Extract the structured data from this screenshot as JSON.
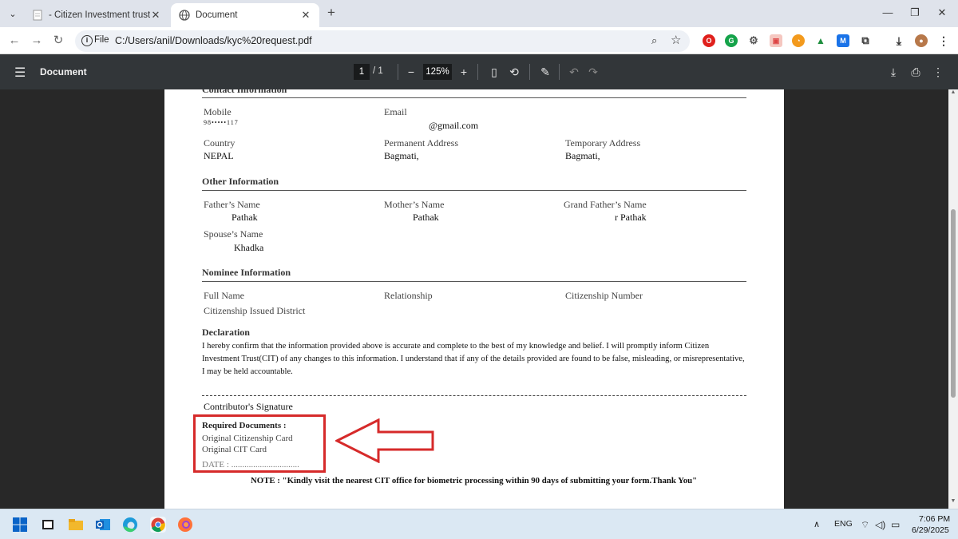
{
  "browser": {
    "tabs": [
      {
        "title": "- Citizen Investment trust from",
        "active": false
      },
      {
        "title": "Document",
        "active": true
      }
    ],
    "address": {
      "scheme_label": "File",
      "url": "C:/Users/anil/Downloads/kyc%20request.pdf"
    }
  },
  "pdf_toolbar": {
    "title": "Document",
    "page_current": "1",
    "page_total": "/ 1",
    "zoom": "125%"
  },
  "document": {
    "contact_heading": "Contact Information",
    "contact": {
      "mobile_label": "Mobile",
      "mobile_value": "98•••••117",
      "email_label": "Email",
      "email_value": "@gmail.com",
      "country_label": "Country",
      "country_value": "NEPAL",
      "permanent_label": "Permanent Address",
      "permanent_value": "Bagmati,",
      "temporary_label": "Temporary Address",
      "temporary_value": "Bagmati,"
    },
    "other_heading": "Other Information",
    "other": {
      "father_label": "Father’s Name",
      "father_value": "Pathak",
      "mother_label": "Mother’s Name",
      "mother_value": "Pathak",
      "grandfather_label": "Grand Father’s Name",
      "grandfather_value": "r Pathak",
      "spouse_label": "Spouse’s Name",
      "spouse_value": "Khadka"
    },
    "nominee_heading": "Nominee Information",
    "nominee": {
      "fullname_label": "Full Name",
      "relationship_label": "Relationship",
      "citizenship_label": "Citizenship Number",
      "district_label": "Citizenship Issued District"
    },
    "declaration_heading": "Declaration",
    "declaration_text": "I hereby confirm that the information provided above is accurate and complete to the best of my knowledge and belief. I will promptly inform Citizen Investment Trust(CIT) of any changes to this information. I understand that if any of the details provided are found to be false, misleading, or misrepresentative, I may be held accountable.",
    "signature_label": "Contributor's Signature",
    "required_heading": "Required Documents :",
    "required_items": [
      "Original Citizenship Card",
      "Original CIT Card"
    ],
    "date_label": "DATE : ...............................",
    "note": "NOTE : \"Kindly visit the nearest CIT office for biometric processing within 90 days of submitting your form.Thank You\""
  },
  "taskbar": {
    "language": "ENG",
    "time": "7:06 PM",
    "date": "6/29/2025"
  },
  "colors": {
    "highlight_red": "#d62a2a",
    "pdf_toolbar": "#323639",
    "viewer_bg": "#282828"
  }
}
